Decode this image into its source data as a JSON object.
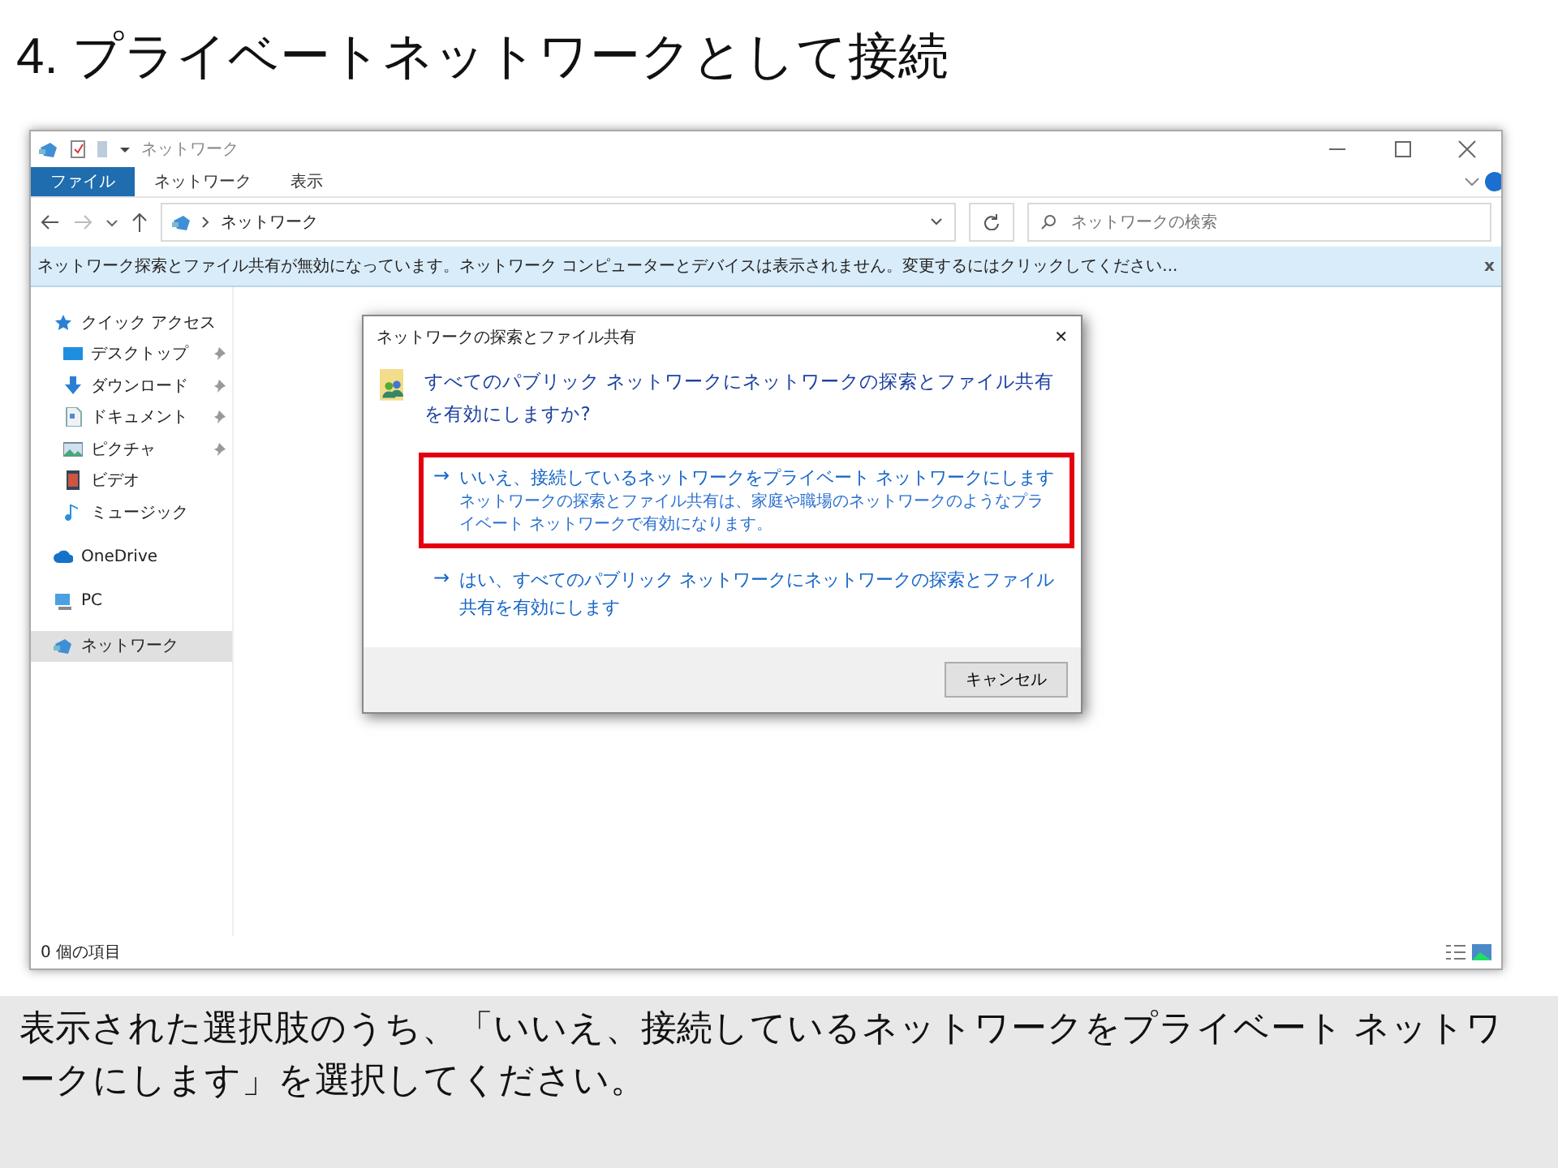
{
  "slide_title": "4. プライベートネットワークとして接続",
  "window": {
    "title": "ネットワーク",
    "ribbon_tabs": [
      {
        "label": "ファイル",
        "selected": true
      },
      {
        "label": "ネットワーク",
        "selected": false
      },
      {
        "label": "表示",
        "selected": false
      }
    ],
    "address": "ネットワーク",
    "search": {
      "placeholder": "ネットワークの検索"
    },
    "info_bar": "ネットワーク探索とファイル共有が無効になっています。ネットワーク コンピューターとデバイスは表示されません。変更するにはクリックしてください...",
    "info_close": "x",
    "sidebar": {
      "items": [
        {
          "label": "クイック アクセス",
          "kind": "star",
          "selected": false,
          "children": [
            {
              "label": "デスクトップ",
              "kind": "desktop",
              "pinned": true,
              "selected": false
            },
            {
              "label": "ダウンロード",
              "kind": "download",
              "pinned": true,
              "selected": false
            },
            {
              "label": "ドキュメント",
              "kind": "document",
              "pinned": true,
              "selected": false
            },
            {
              "label": "ピクチャ",
              "kind": "pictures",
              "pinned": true,
              "selected": false
            },
            {
              "label": "ビデオ",
              "kind": "video",
              "pinned": false,
              "selected": false
            },
            {
              "label": "ミュージック",
              "kind": "music",
              "pinned": false,
              "selected": false
            }
          ]
        },
        {
          "label": "OneDrive",
          "kind": "cloud",
          "selected": false
        },
        {
          "label": "PC",
          "kind": "pc",
          "selected": false
        },
        {
          "label": "ネットワーク",
          "kind": "network",
          "selected": true
        }
      ]
    },
    "status_bar": "0 個の項目",
    "dialog": {
      "title": "ネットワークの探索とファイル共有",
      "close": "✕",
      "question": "すべてのパブリック ネットワークにネットワークの探索とファイル共有を有効にしますか?",
      "options": [
        {
          "arrow": "→",
          "label": "いいえ、接続しているネットワークをプライベート ネットワークにします",
          "description": "ネットワークの探索とファイル共有は、家庭や職場のネットワークのようなプライベート ネットワークで有効になります。",
          "highlighted": true
        },
        {
          "arrow": "→",
          "label": "はい、すべてのパブリック ネットワークにネットワークの探索とファイル共有を有効にします",
          "highlighted": false
        }
      ],
      "buttons": [
        "キャンセル"
      ]
    }
  },
  "caption": "表示された選択肢のうち、「いいえ、接続しているネットワークをプライベート ネットワークにします」を選択してください。"
}
